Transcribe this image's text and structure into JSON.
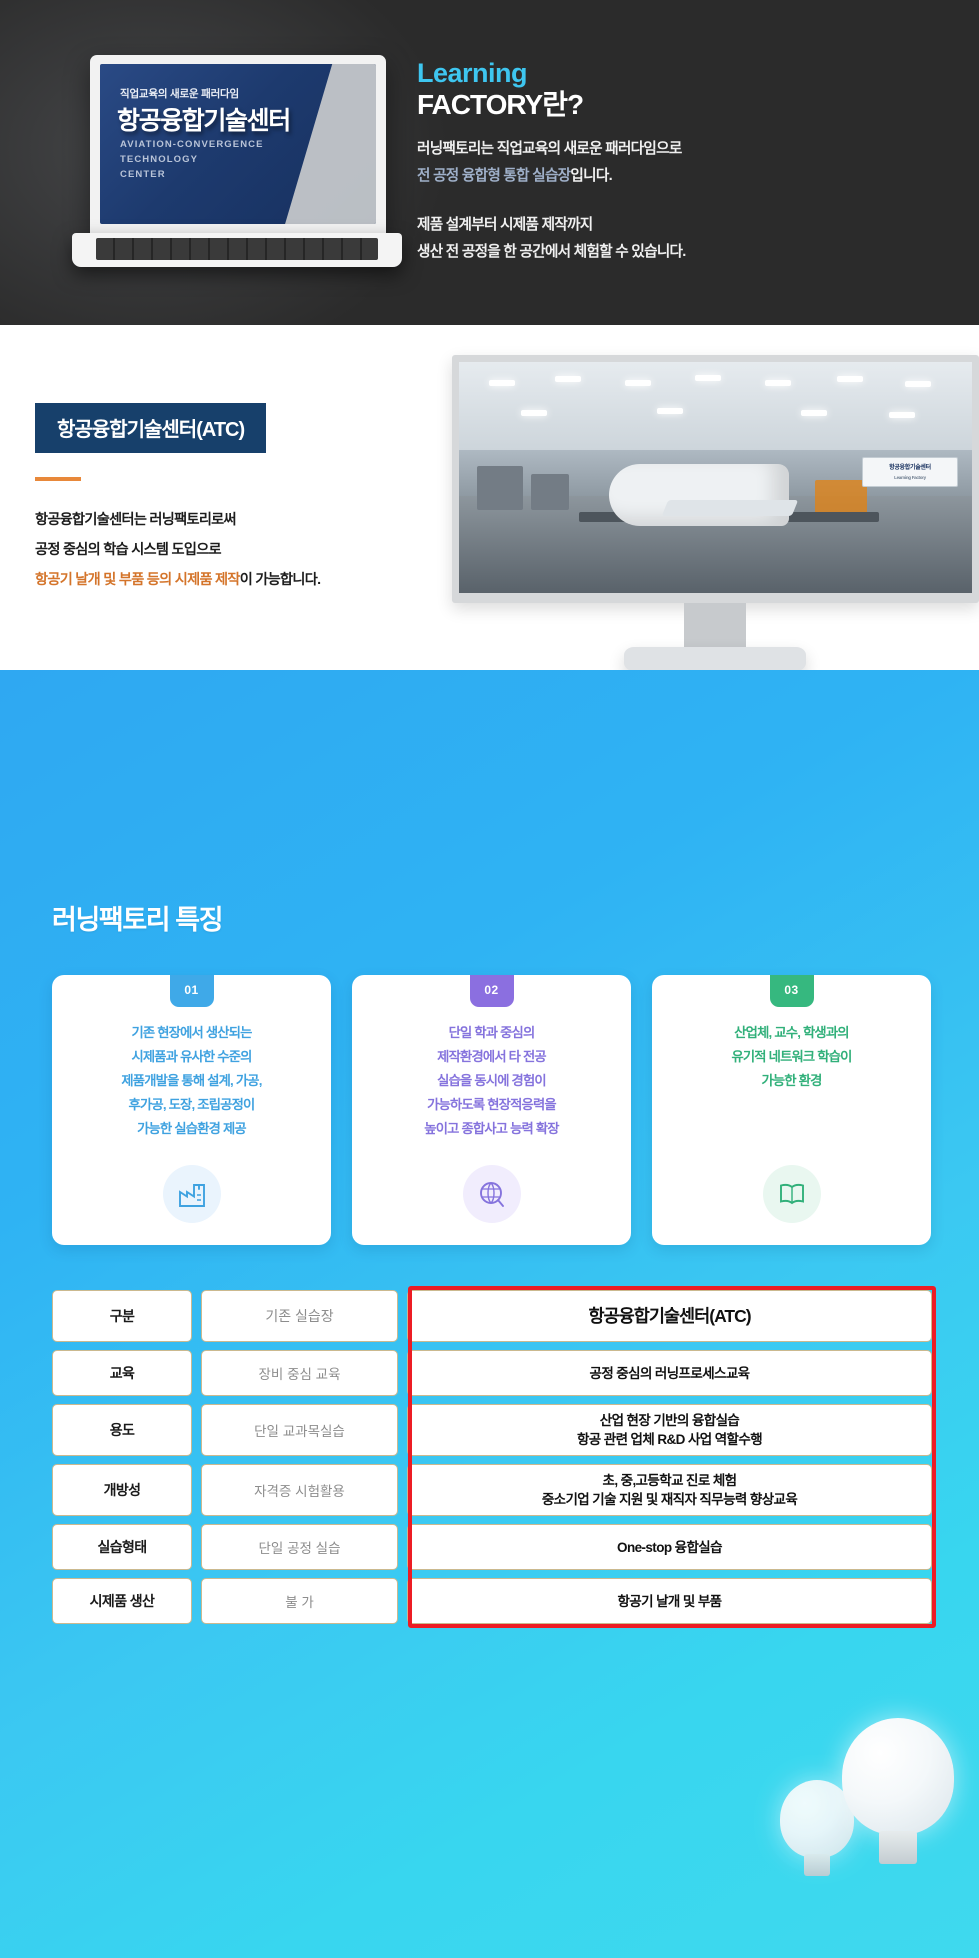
{
  "hero": {
    "laptop_screen": {
      "sub": "직업교육의 새로운 패러다임",
      "title": "항공융합기술센터",
      "en_line1": "AVIATION-CONVERGENCE",
      "en_line2": "TECHNOLOGY",
      "en_line3": "CENTER"
    },
    "brand_line1": "Learning",
    "brand_line2": "FACTORY란?",
    "p1_strong": "러닝팩토리는 직업교육의 새로운 패러다임으로",
    "p1_muted": "전 공정 융합형 통합 실습장",
    "p1_tail": "입니다.",
    "p2_line1": "제품 설계부터 시제품 제작까지",
    "p2_line2": "생산 전 공정을 한 공간에서 체험할 수 있습니다."
  },
  "section2": {
    "badge": "항공융합기술센터(ATC)",
    "line1": "항공융합기술센터는 러닝팩토리로써",
    "line2": "공정 중심의 학습 시스템 도입으로",
    "line3_hl": "항공기 날개 및 부품 등의 시제품 제작",
    "line3_tail": "이 가능합니다.",
    "monitor_banner": "항공융합기술센터",
    "monitor_banner_sub": "Learning Factory"
  },
  "section3": {
    "title": "러닝팩토리 특징",
    "cards": [
      {
        "num": "01",
        "color": "#3fa9e8",
        "icon": "factory-icon",
        "lines": [
          "기존 현장에서 생산되는",
          "시제품과 유사한 수준의",
          "제품개발을 통해 설계, 가공,",
          "후가공, 도장, 조립공정이",
          "가능한 실습환경 제공"
        ]
      },
      {
        "num": "02",
        "color": "#8b6fe0",
        "icon": "globe-icon",
        "lines": [
          "단일 학과 중심의",
          "제작환경에서 타 전공",
          "실습을 동시에 경험이",
          "가능하도록 현장적응력을",
          "높이고 종합사고 능력 확장"
        ]
      },
      {
        "num": "03",
        "color": "#36b87f",
        "icon": "book-icon",
        "lines": [
          "산업체, 교수, 학생과의",
          "유기적 네트워크 학습이",
          "가능한 환경"
        ]
      }
    ],
    "table": {
      "highlight_color": "#ed1c24",
      "rows": [
        {
          "label": "구분",
          "existing": "기존 실습장",
          "atc": [
            "항공융합기술센터(ATC)"
          ]
        },
        {
          "label": "교육",
          "existing": "장비 중심 교육",
          "atc": [
            "공정 중심의 러닝프로세스교육"
          ]
        },
        {
          "label": "용도",
          "existing": "단일 교과목실습",
          "atc": [
            "산업 현장 기반의 융합실습",
            "항공 관련 업체 R&D 사업 역할수행"
          ]
        },
        {
          "label": "개방성",
          "existing": "자격증 시험활용",
          "atc": [
            "초, 중,고등학교 진로 체험",
            "중소기업 기술 지원 및 재직자 직무능력 향상교육"
          ]
        },
        {
          "label": "실습형태",
          "existing": "단일 공정 실습",
          "atc": [
            "One-stop 융합실습"
          ]
        },
        {
          "label": "시제품 생산",
          "existing": "불 가",
          "atc": [
            "항공기 날개 및 부품"
          ]
        }
      ]
    }
  }
}
